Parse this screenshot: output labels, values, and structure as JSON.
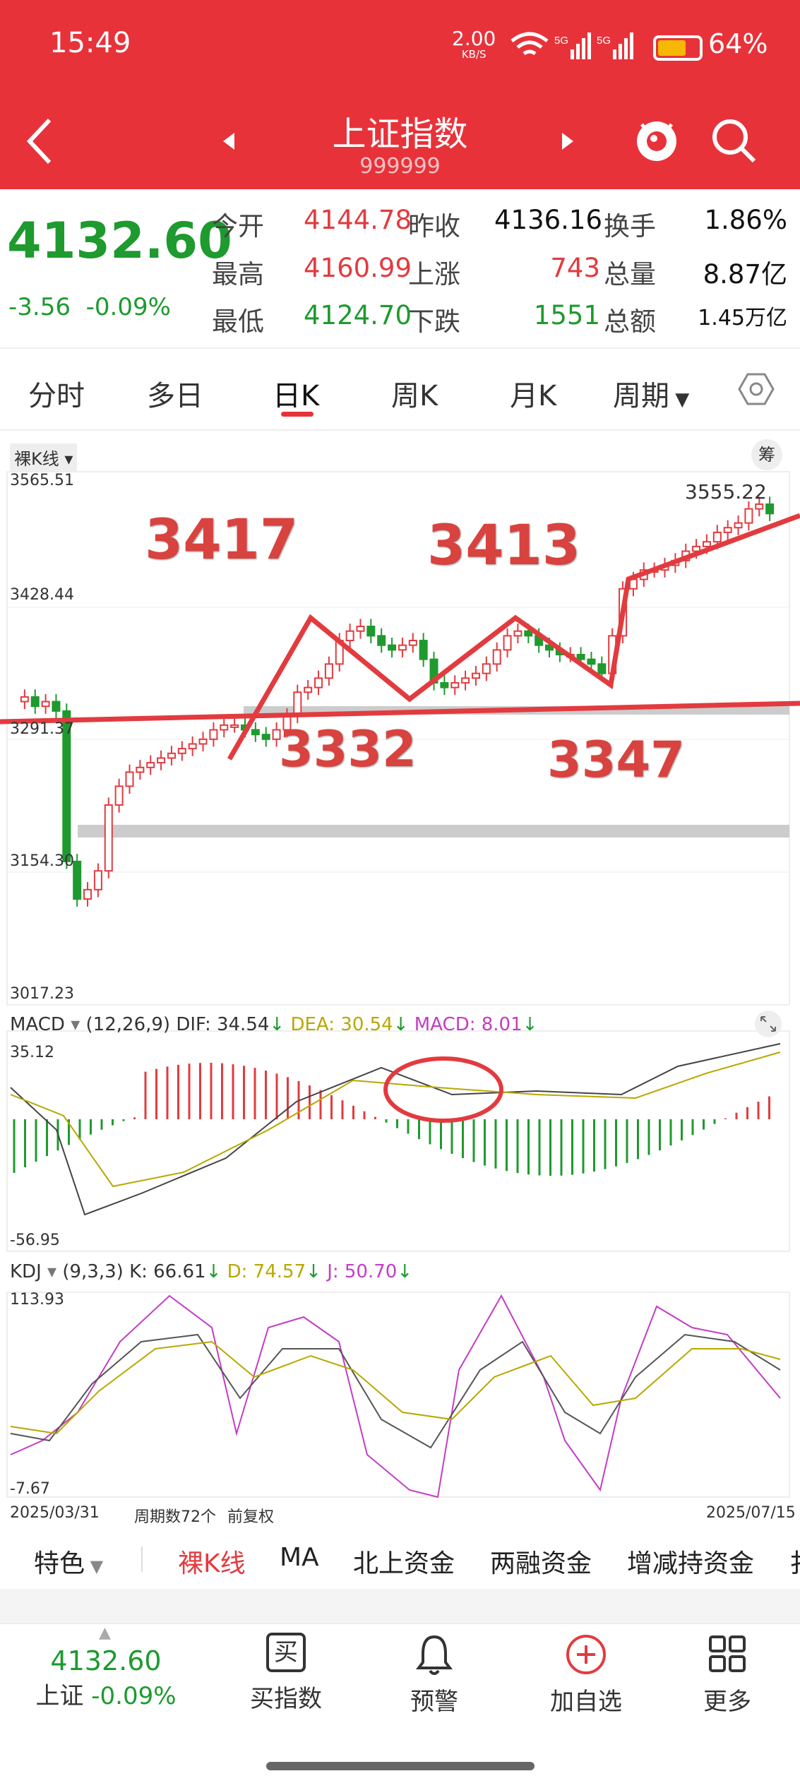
{
  "status_bar": {
    "time": "15:49",
    "net_speed": "2.00",
    "net_unit": "KB/S",
    "battery": "64%",
    "colors": {
      "battery_fill": "#f6b800"
    }
  },
  "header": {
    "title": "上证指数",
    "code": "999999",
    "bg_color": "#e8323a"
  },
  "quote": {
    "price": "4132.60",
    "change": "-3.56",
    "change_pct": "-0.09%",
    "cells": [
      {
        "label": "今开",
        "value": "4144.78",
        "tone": "red"
      },
      {
        "label": "昨收",
        "value": "4136.16",
        "tone": "blk"
      },
      {
        "label": "换手",
        "value": "1.86%",
        "tone": "blk"
      },
      {
        "label": "最高",
        "value": "4160.99",
        "tone": "red"
      },
      {
        "label": "上涨",
        "value": "743",
        "tone": "red"
      },
      {
        "label": "总量",
        "value": "8.87亿",
        "tone": "blk"
      },
      {
        "label": "最低",
        "value": "4124.70",
        "tone": "green"
      },
      {
        "label": "下跌",
        "value": "1551",
        "tone": "green"
      },
      {
        "label": "总额",
        "value": "1.45万亿",
        "tone": "blk"
      }
    ]
  },
  "tabs": [
    "分时",
    "多日",
    "日K",
    "周K",
    "月K",
    "周期"
  ],
  "active_tab": "日K",
  "chart": {
    "kline_label": "裸K线",
    "chip_label": "筹",
    "y_ticks": [
      "3565.51",
      "3428.44",
      "3291.37",
      "3154.30",
      "3017.23"
    ],
    "max_label": "3555.22",
    "annotations": [
      "3417",
      "3413",
      "3332",
      "3347"
    ],
    "macd_header": {
      "name": "MACD",
      "params": "(12,26,9)",
      "dif": "DIF: 34.54",
      "dea": "DEA: 30.54",
      "macd": "MACD: 8.01"
    },
    "macd_ticks": [
      "35.12",
      "-56.95"
    ],
    "kdj_header": {
      "name": "KDJ",
      "params": "(9,3,3)",
      "k": "K: 66.61",
      "d": "D: 74.57",
      "j": "J: 50.70"
    },
    "kdj_ticks": [
      "113.93",
      "-7.67"
    ],
    "date_start": "2025/03/31",
    "period_count": "周期数72个",
    "adjust": "前复权",
    "date_end": "2025/07/15"
  },
  "indicator_tabs": [
    "特色",
    "裸K线",
    "MA",
    "北上资金",
    "两融资金",
    "增减持资金",
    "扌"
  ],
  "bottom_bar": {
    "price": "4132.60",
    "name": "上证",
    "pct": "-0.09%",
    "buy_icon_char": "买",
    "buy": "买指数",
    "alert": "预警",
    "add": "加自选",
    "more": "更多"
  }
}
